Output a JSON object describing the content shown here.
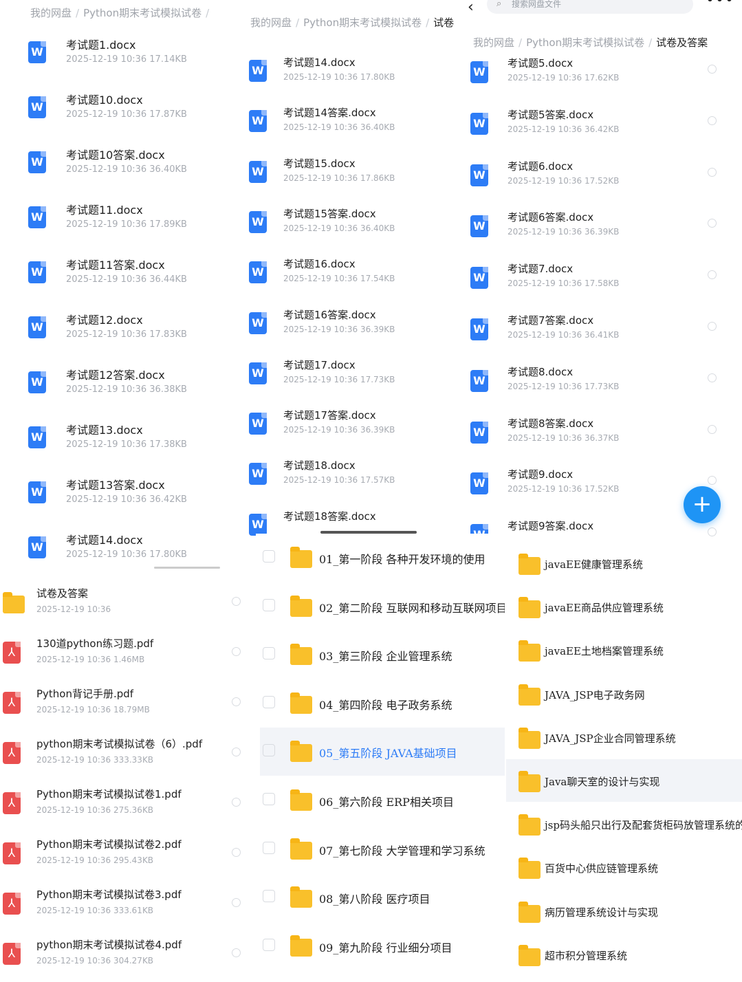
{
  "panel1": {
    "crumb": [
      "我的网盘",
      "Python期末考试模拟试卷"
    ],
    "files": [
      {
        "name": "考试题1.docx",
        "meta": "2025-12-19  10:36  17.14KB"
      },
      {
        "name": "考试题10.docx",
        "meta": "2025-12-19  10:36  17.87KB"
      },
      {
        "name": "考试题10答案.docx",
        "meta": "2025-12-19  10:36  36.40KB"
      },
      {
        "name": "考试题11.docx",
        "meta": "2025-12-19  10:36  17.89KB"
      },
      {
        "name": "考试题11答案.docx",
        "meta": "2025-12-19  10:36  36.44KB"
      },
      {
        "name": "考试题12.docx",
        "meta": "2025-12-19  10:36  17.83KB"
      },
      {
        "name": "考试题12答案.docx",
        "meta": "2025-12-19  10:36  36.38KB"
      },
      {
        "name": "考试题13.docx",
        "meta": "2025-12-19  10:36  17.38KB"
      },
      {
        "name": "考试题13答案.docx",
        "meta": "2025-12-19  10:36  36.42KB"
      },
      {
        "name": "考试题14.docx",
        "meta": "2025-12-19  10:36  17.80KB"
      }
    ]
  },
  "panel2": {
    "crumb": [
      "我的网盘",
      "Python期末考试模拟试卷",
      "试卷"
    ],
    "files": [
      {
        "name": "考试题14.docx",
        "meta": "2025-12-19  10:36  17.80KB"
      },
      {
        "name": "考试题14答案.docx",
        "meta": "2025-12-19  10:36  36.40KB"
      },
      {
        "name": "考试题15.docx",
        "meta": "2025-12-19  10:36  17.86KB"
      },
      {
        "name": "考试题15答案.docx",
        "meta": "2025-12-19  10:36  36.40KB"
      },
      {
        "name": "考试题16.docx",
        "meta": "2025-12-19  10:36  17.54KB"
      },
      {
        "name": "考试题16答案.docx",
        "meta": "2025-12-19  10:36  36.39KB"
      },
      {
        "name": "考试题17.docx",
        "meta": "2025-12-19  10:36  17.73KB"
      },
      {
        "name": "考试题17答案.docx",
        "meta": "2025-12-19  10:36  36.39KB"
      },
      {
        "name": "考试题18.docx",
        "meta": "2025-12-19  10:36  17.57KB"
      },
      {
        "name": "考试题18答案.docx",
        "meta": ""
      }
    ]
  },
  "panel3": {
    "search_placeholder": "搜索网盘文件",
    "more_icon": "more-icon",
    "crumb": [
      "我的网盘",
      "Python期末考试模拟试卷",
      "试卷及答案"
    ],
    "files": [
      {
        "name": "考试题5.docx",
        "meta": "2025-12-19  10:36  17.62KB"
      },
      {
        "name": "考试题5答案.docx",
        "meta": "2025-12-19  10:36  36.42KB"
      },
      {
        "name": "考试题6.docx",
        "meta": "2025-12-19  10:36  17.52KB"
      },
      {
        "name": "考试题6答案.docx",
        "meta": "2025-12-19  10:36  36.39KB"
      },
      {
        "name": "考试题7.docx",
        "meta": "2025-12-19  10:36  17.58KB"
      },
      {
        "name": "考试题7答案.docx",
        "meta": "2025-12-19  10:36  36.41KB"
      },
      {
        "name": "考试题8.docx",
        "meta": "2025-12-19  10:36  17.73KB"
      },
      {
        "name": "考试题8答案.docx",
        "meta": "2025-12-19  10:36  36.37KB"
      },
      {
        "name": "考试题9.docx",
        "meta": "2025-12-19  10:36  17.52KB"
      },
      {
        "name": "考试题9答案.docx",
        "meta": ""
      }
    ],
    "fab_label": "+"
  },
  "panel4": {
    "items": [
      {
        "type": "folder",
        "name": "试卷及答案",
        "meta": "2025-12-19  10:36"
      },
      {
        "type": "pdf",
        "name": "130道python练习题.pdf",
        "meta": "2025-12-19  10:36  1.46MB"
      },
      {
        "type": "pdf",
        "name": "Python背记手册.pdf",
        "meta": "2025-12-19  10:36  18.79MB"
      },
      {
        "type": "pdf",
        "name": "python期末考试模拟试卷（6）.pdf",
        "meta": "2025-12-19  10:36  333.33KB"
      },
      {
        "type": "pdf",
        "name": "Python期末考试模拟试卷1.pdf",
        "meta": "2025-12-19  10:36  275.36KB"
      },
      {
        "type": "pdf",
        "name": "Python期末考试模拟试卷2.pdf",
        "meta": "2025-12-19  10:36  295.43KB"
      },
      {
        "type": "pdf",
        "name": "Python期末考试模拟试卷3.pdf",
        "meta": "2025-12-19  10:36  333.61KB"
      },
      {
        "type": "pdf",
        "name": "python期末考试模拟试卷4.pdf",
        "meta": "2025-12-19  10:36  304.27KB"
      }
    ]
  },
  "panel5": {
    "folders": [
      "01_第一阶段 各种开发环境的使用",
      "02_第二阶段 互联网和移动互联网项目",
      "03_第三阶段 企业管理系统",
      "04_第四阶段 电子政务系统",
      "05_第五阶段 JAVA基础项目",
      "06_第六阶段 ERP相关项目",
      "07_第七阶段 大学管理和学习系统",
      "08_第八阶段 医疗项目",
      "09_第九阶段 行业细分项目"
    ],
    "highlight_color": "#2d7cf6"
  },
  "panel6": {
    "folders": [
      "javaEE健康管理系统",
      "javaEE商品供应管理系统",
      "javaEE土地档案管理系统",
      "JAVA_JSP电子政务网",
      "JAVA_JSP企业合同管理系统",
      "Java聊天室的设计与实现",
      "jsp码头船只出行及配套货柜码放管理系统的",
      "百货中心供应链管理系统",
      "病历管理系统设计与实现",
      "超市积分管理系统"
    ]
  }
}
